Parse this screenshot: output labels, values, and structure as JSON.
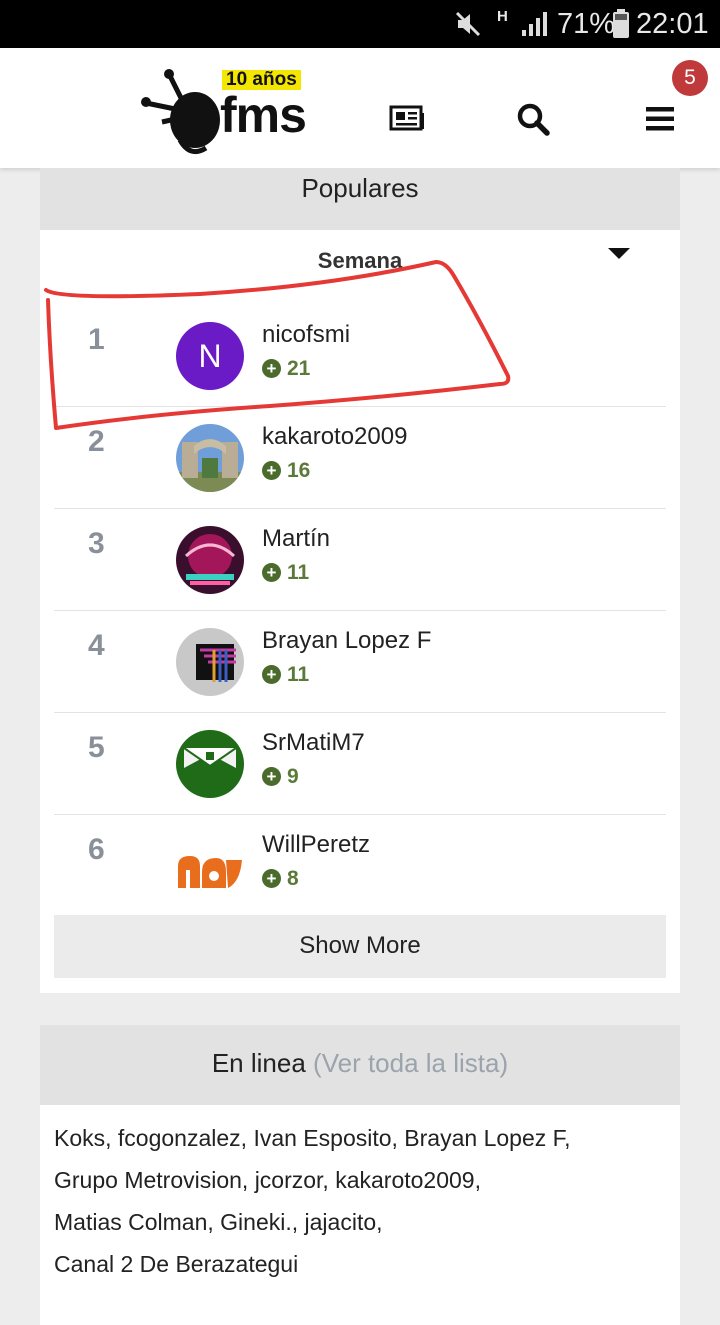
{
  "status_bar": {
    "battery": "71%",
    "time": "22:01",
    "network": "H"
  },
  "header": {
    "logo_text": "fms",
    "logo_anniversary": "10 años",
    "notifications_count": "5",
    "icons": [
      "news-icon",
      "search-icon",
      "menu-icon"
    ]
  },
  "populares": {
    "title": "Populares",
    "period": "Semana",
    "rows": [
      {
        "rank": "1",
        "name": "nicofsmi",
        "score": "21",
        "avatar_letter": "N",
        "avatar_color": "#6a1bc6"
      },
      {
        "rank": "2",
        "name": "kakaroto2009",
        "score": "16"
      },
      {
        "rank": "3",
        "name": "Martín",
        "score": "11"
      },
      {
        "rank": "4",
        "name": "Brayan Lopez F",
        "score": "11"
      },
      {
        "rank": "5",
        "name": "SrMatiM7",
        "score": "9"
      },
      {
        "rank": "6",
        "name": "WillPeretz",
        "score": "8"
      }
    ],
    "show_more": "Show More"
  },
  "online": {
    "title": "En linea",
    "link": "(Ver toda la lista)",
    "lines": [
      "Koks, fcogonzalez, Ivan Esposito, Brayan Lopez F,",
      "Grupo Metrovision, jcorzor, kakaroto2009,",
      "Matias Colman, Gineki., jajacito,",
      "Canal 2 De Berazategui"
    ]
  },
  "colors": {
    "score_green": "#5b7a3a",
    "badge_red": "#c0393b",
    "annotation_red": "#e53935"
  }
}
